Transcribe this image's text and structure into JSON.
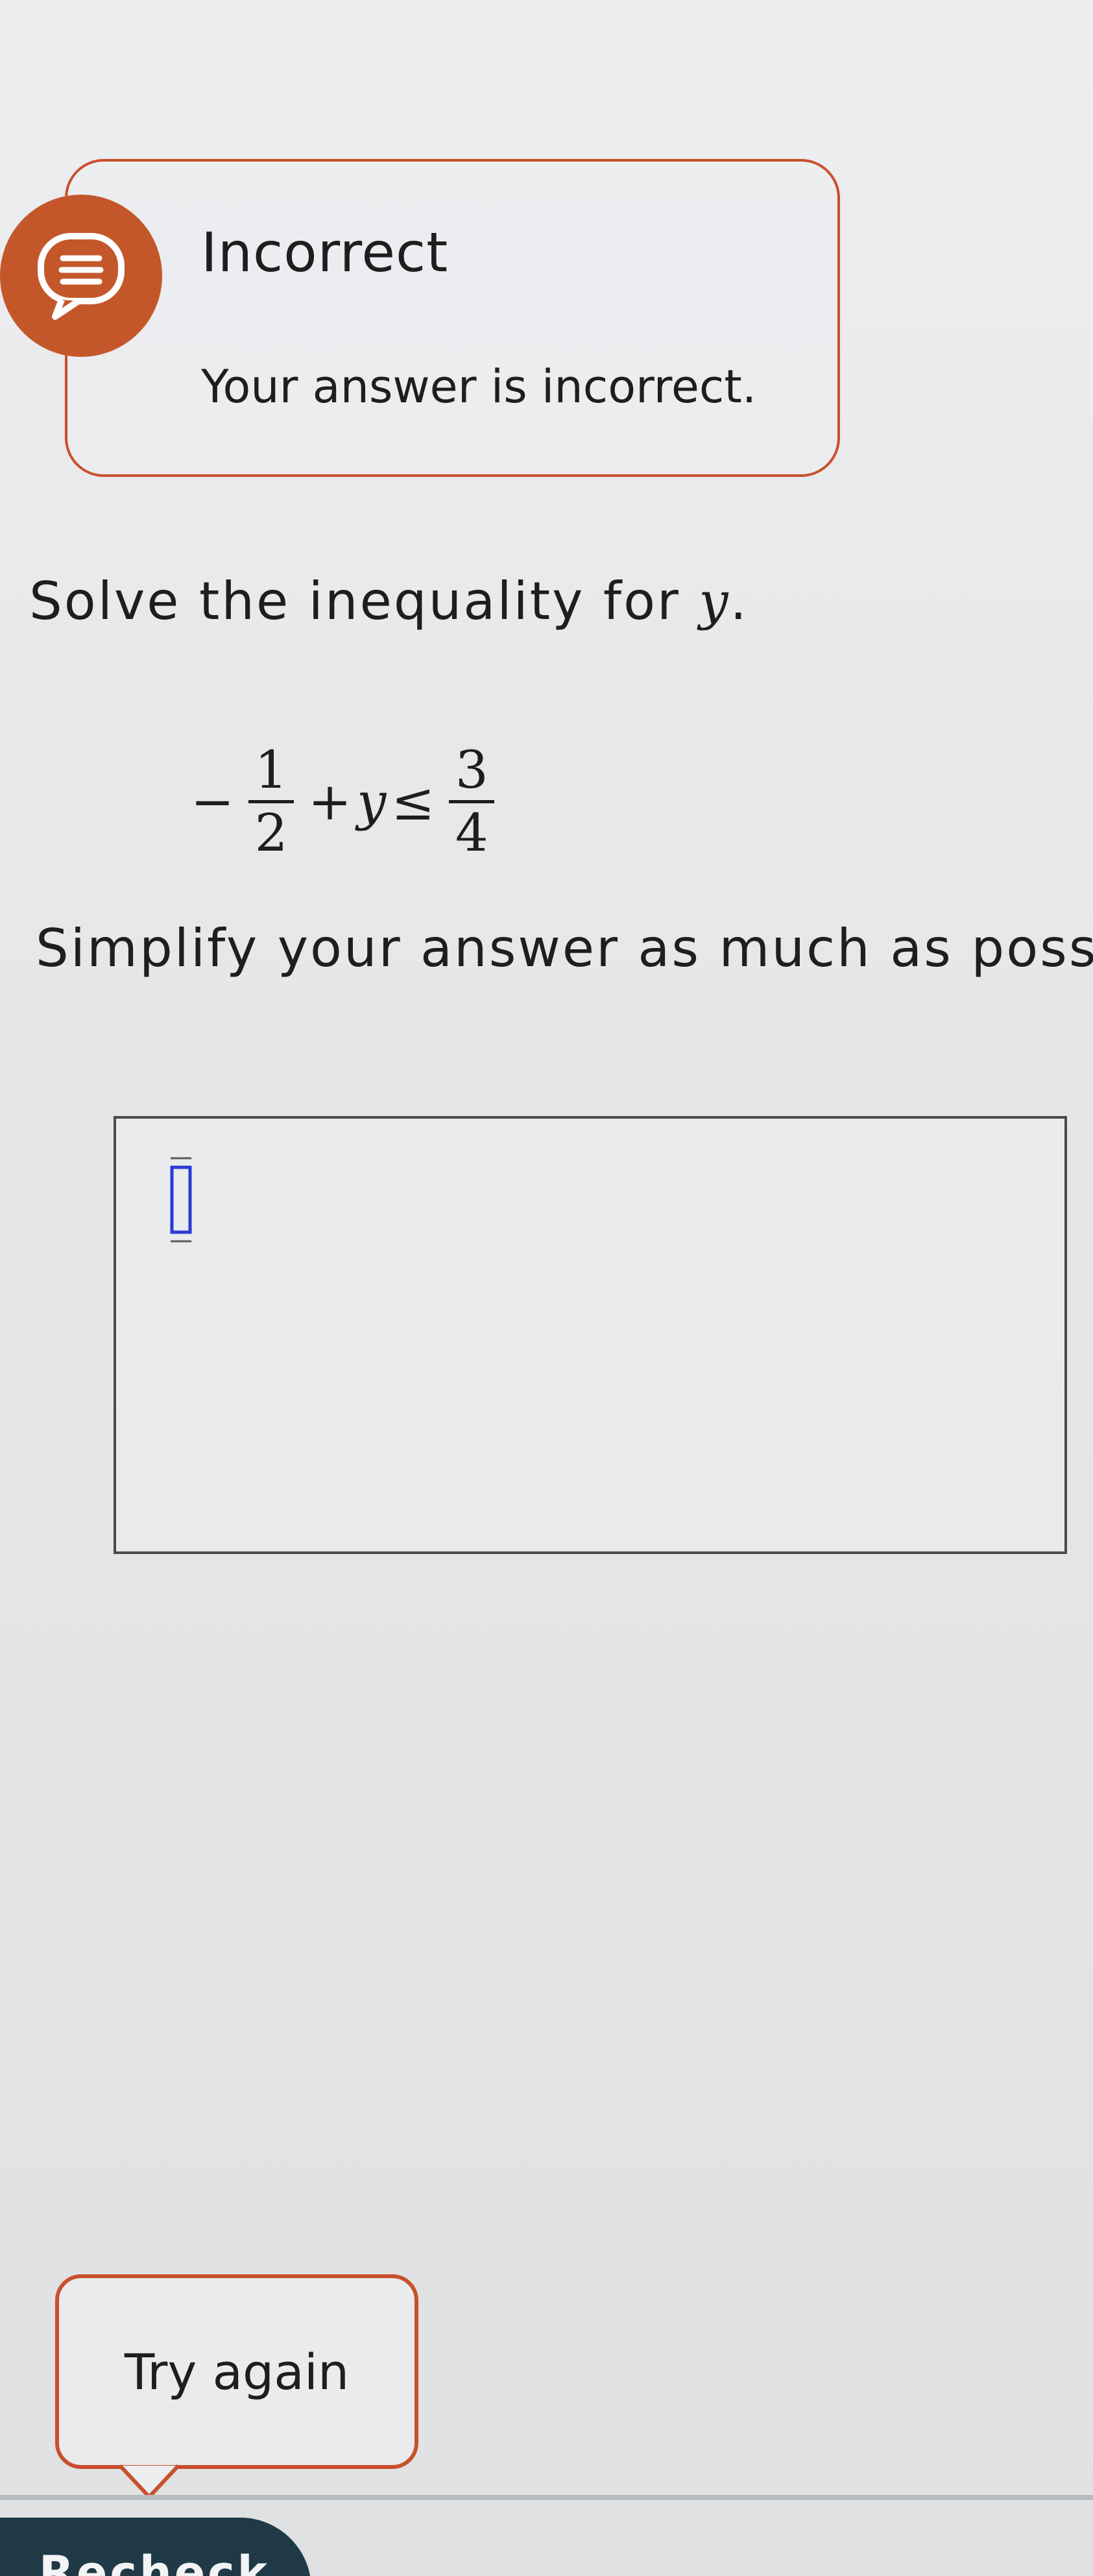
{
  "feedback": {
    "icon": "chat-bubble-icon",
    "title": "Incorrect",
    "message": "Your answer is incorrect.",
    "accent_color": "#c8502d"
  },
  "question": {
    "prompt_prefix": "Solve the inequality for ",
    "prompt_variable": "y",
    "prompt_suffix": ".",
    "inequality": {
      "sign_left": "−",
      "frac1_num": "1",
      "frac1_den": "2",
      "plus": "+",
      "variable": "y",
      "relation": "≤",
      "frac2_num": "3",
      "frac2_den": "4"
    },
    "instruction": "Simplify your answer as much as possil"
  },
  "answer": {
    "value": "",
    "cursor_icon": "text-cursor-icon"
  },
  "actions": {
    "try_again_label": "Try again",
    "bottom_button_label": "Recheck"
  }
}
